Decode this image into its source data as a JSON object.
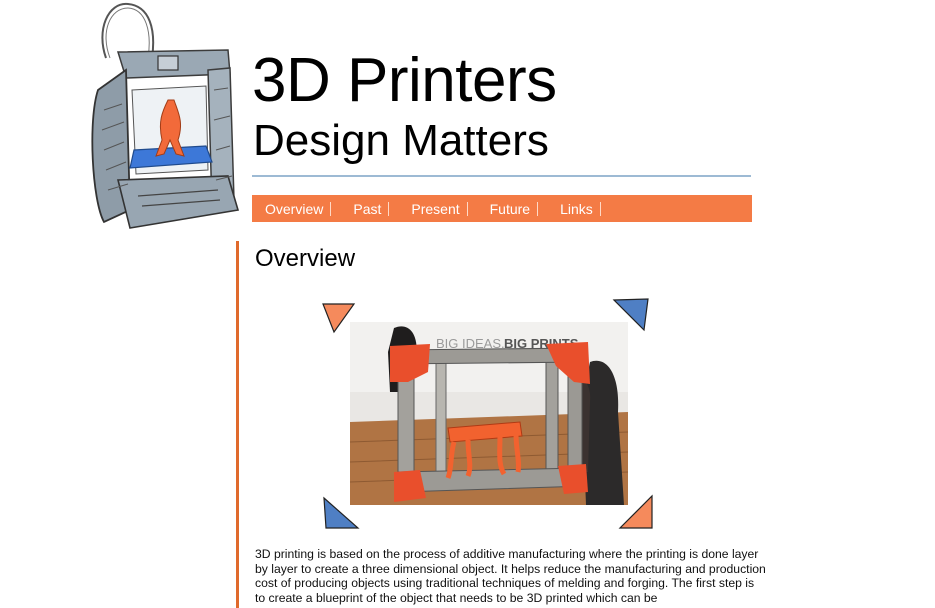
{
  "header": {
    "title": "3D Printers",
    "subtitle": "Design Matters"
  },
  "nav": {
    "items": [
      {
        "label": "Overview"
      },
      {
        "label": "Past"
      },
      {
        "label": "Present"
      },
      {
        "label": "Future"
      },
      {
        "label": "Links"
      }
    ]
  },
  "main": {
    "section_title": "Overview",
    "photo_sign_left": "BIG IDEAS.",
    "photo_sign_right": "BIG PRINTS",
    "paragraph": "3D printing is based on the process of additive manufacturing where the printing is done layer by layer to create a three dimensional object. It helps reduce the manufacturing and production cost of producing objects using traditional techniques of melding and forging. The first step is to create a blueprint of the object that needs to be 3D printed which can be"
  },
  "colors": {
    "accent": "#f47b45",
    "divider": "#9dbad4",
    "corner_blue": "#4f7fc4"
  },
  "icons": {
    "logo": "sketched-3d-printer-icon"
  }
}
